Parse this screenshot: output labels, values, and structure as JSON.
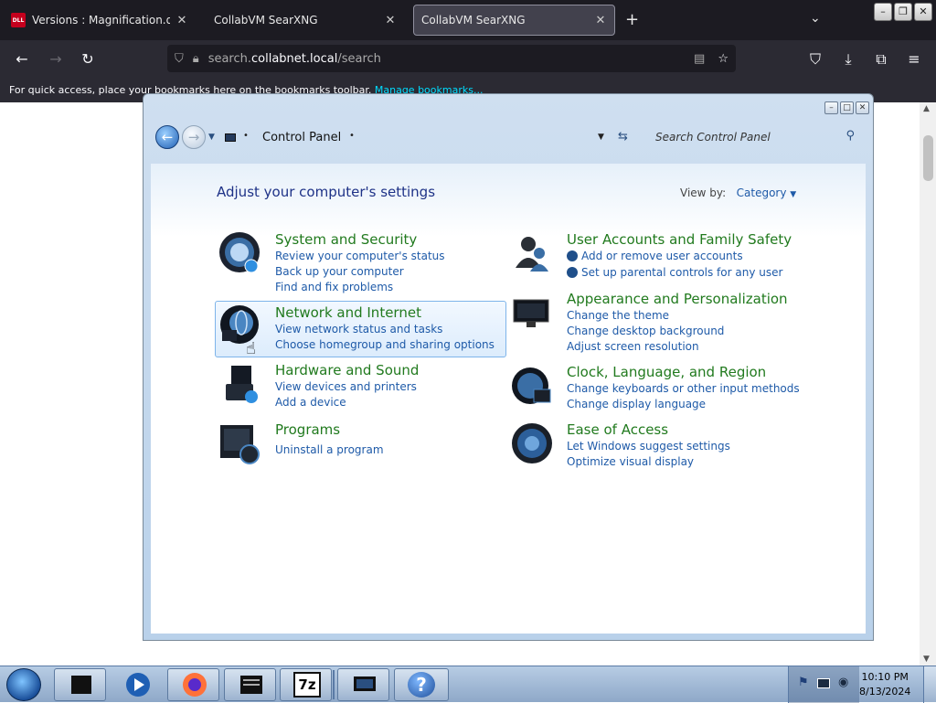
{
  "browser": {
    "tabs": [
      {
        "favicon": "DLL",
        "title": "Versions : Magnification.dll : Fil"
      },
      {
        "title": "CollabVM SearXNG"
      },
      {
        "title": "CollabVM SearXNG"
      }
    ],
    "url_prefix": "search.",
    "url_domain": "collabnet.local",
    "url_path": "/search",
    "bookmarks_message": "For quick access, place your bookmarks here on the bookmarks toolbar.",
    "bookmarks_link": "Manage bookmarks..."
  },
  "control_panel": {
    "breadcrumb": "Control Panel",
    "search_placeholder": "Search Control Panel",
    "heading": "Adjust your computer's settings",
    "view_by_label": "View by:",
    "view_by_value": "Category",
    "categories": [
      {
        "name": "System and Security",
        "links": [
          "Review your computer's status",
          "Back up your computer",
          "Find and fix problems"
        ]
      },
      {
        "name": "Network and Internet",
        "links": [
          "View network status and tasks",
          "Choose homegroup and sharing options"
        ]
      },
      {
        "name": "Hardware and Sound",
        "links": [
          "View devices and printers",
          "Add a device"
        ]
      },
      {
        "name": "Programs",
        "links": [
          "Uninstall a program"
        ]
      },
      {
        "name": "User Accounts and Family Safety",
        "links": [
          "Add or remove user accounts",
          "Set up parental controls for any user"
        ]
      },
      {
        "name": "Appearance and Personalization",
        "links": [
          "Change the theme",
          "Change desktop background",
          "Adjust screen resolution"
        ]
      },
      {
        "name": "Clock, Language, and Region",
        "links": [
          "Change keyboards or other input methods",
          "Change display language"
        ]
      },
      {
        "name": "Ease of Access",
        "links": [
          "Let Windows suggest settings",
          "Optimize visual display"
        ]
      }
    ]
  },
  "taskbar": {
    "time": "10:10 PM",
    "date": "8/13/2024",
    "sevenzip_label": "7z",
    "help_label": "?"
  },
  "colors": {
    "category_green": "#217a1e",
    "link_blue": "#1e5aa8",
    "heading_blue": "#1e3287"
  }
}
